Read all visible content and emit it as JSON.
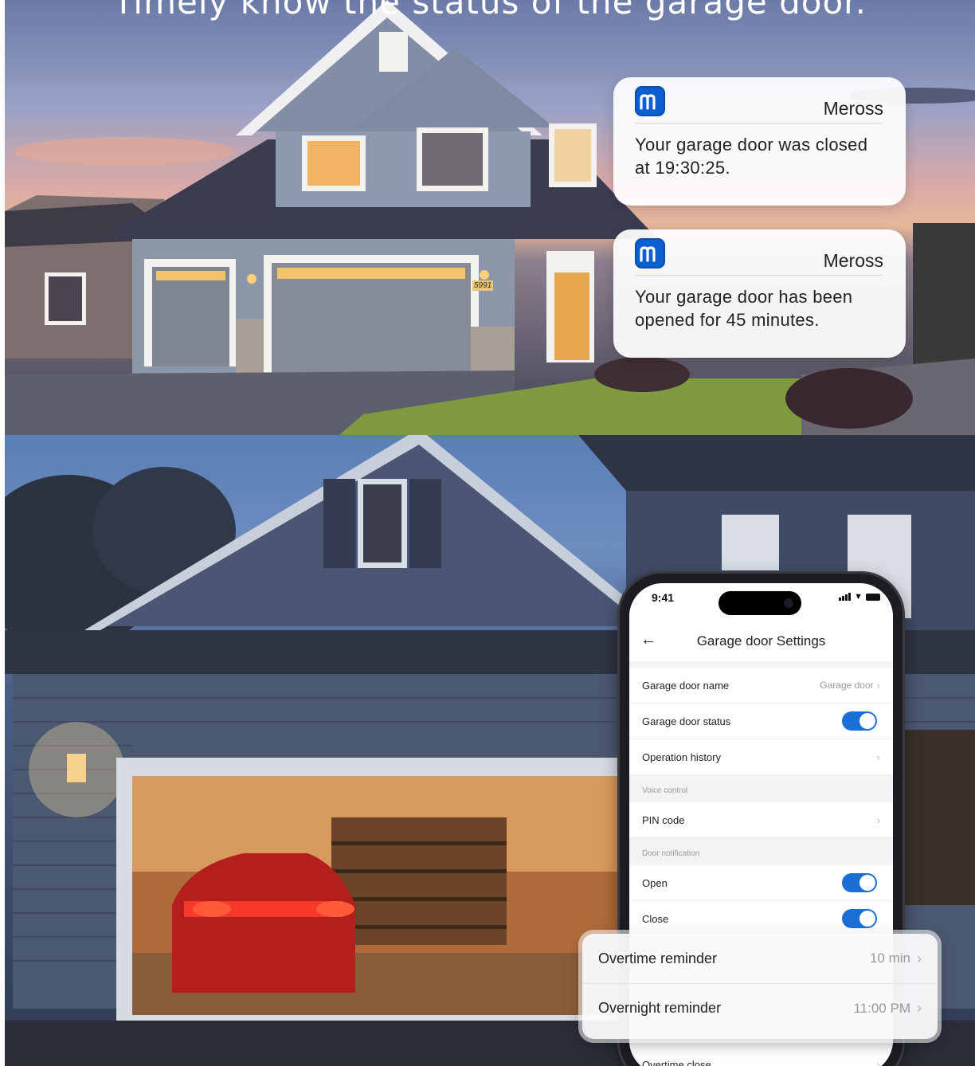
{
  "headline": "Timely know the status of the garage door.",
  "house_number": "5991",
  "notifications": [
    {
      "app": "Meross",
      "message": "Your garage door was closed at 19:30:25.",
      "icon": "meross-logo-icon"
    },
    {
      "app": "Meross",
      "message": "Your garage door has been opened for 45 minutes.",
      "icon": "meross-logo-icon"
    }
  ],
  "phone": {
    "time": "9:41",
    "title": "Garage door Settings",
    "back_icon": "back-arrow-icon",
    "items": {
      "name_label": "Garage door name",
      "name_value": "Garage door",
      "status_label": "Garage door status",
      "status_on": true,
      "history_label": "Operation history",
      "voice_section": "Voice control",
      "pin_label": "PIN code",
      "notif_section": "Door notification",
      "open_label": "Open",
      "open_on": true,
      "close_label": "Close",
      "close_on": true,
      "overtime_close_label": "Overtime close"
    }
  },
  "reminders": {
    "overtime_label": "Overtime reminder",
    "overtime_value": "10 min",
    "overnight_label": "Overnight reminder",
    "overnight_value": "11:00 PM"
  },
  "colors": {
    "accent": "#1a6fd6",
    "brand": "#0b5fcf"
  }
}
